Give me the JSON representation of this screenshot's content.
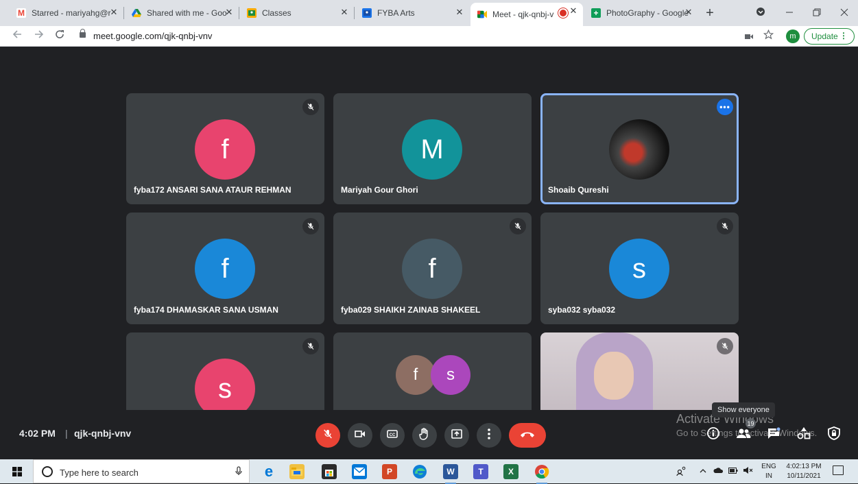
{
  "browser": {
    "tabs": [
      {
        "label": "Starred - mariyahg@r",
        "icon": "gmail-icon",
        "fav_color": "#ea4335",
        "fav_text": "M"
      },
      {
        "label": "Shared with me - Goo",
        "icon": "google-drive-icon",
        "fav_color": "#fbbc04",
        "fav_text": "▲"
      },
      {
        "label": "Classes",
        "icon": "google-classroom-icon",
        "fav_color": "#f9ab00",
        "fav_text": "■"
      },
      {
        "label": "FYBA Arts",
        "icon": "google-classroom-icon",
        "fav_color": "#1a73e8",
        "fav_text": "■"
      },
      {
        "label": "Meet - qjk-qnbj-v",
        "icon": "google-meet-icon",
        "fav_color": "#00832d",
        "fav_text": "■"
      },
      {
        "label": "PhotoGraphy - Google",
        "icon": "google-sheets-icon",
        "fav_color": "#0f9d58",
        "fav_text": "+"
      }
    ],
    "close_glyph": "✕",
    "new_tab_glyph": "+",
    "url": "meet.google.com/qjk-qnbj-vnv",
    "profile_initial": "m",
    "update_label": "Update",
    "menu_glyph": "⋮"
  },
  "meet": {
    "participants": [
      {
        "name": "fyba172 ANSARI SANA ATAUR REHMAN",
        "initial": "f",
        "color": "#e8446e"
      },
      {
        "name": "Mariyah Gour Ghori",
        "initial": "M",
        "color": "#12939a"
      },
      {
        "name": "Shoaib Qureshi",
        "initial": "",
        "color": "#222222"
      },
      {
        "name": "fyba174 DHAMASKAR SANA USMAN",
        "initial": "f",
        "color": "#1a88d8"
      },
      {
        "name": "fyba029 SHAIKH ZAINAB SHAKEEL",
        "initial": "f",
        "color": "#465a65"
      },
      {
        "name": "syba032 syba032",
        "initial": "s",
        "color": "#1a88d8"
      },
      {
        "name": "",
        "initial": "s",
        "color": "#e8446e"
      },
      {
        "name": "",
        "initial": "f",
        "color": "#8d6e63",
        "second_initial": "s",
        "second_color": "#ab47bc"
      },
      {
        "name": "",
        "initial": "",
        "color": "#c9c2c6"
      }
    ],
    "more_glyph": "•••",
    "time": "4:02 PM",
    "divider": "|",
    "meeting_code": "qjk-qnbj-vnv",
    "tooltip": "Show everyone",
    "participant_count": "19",
    "watermark_title": "Activate Windows",
    "watermark_sub": "Go to Settings to activate Windows."
  },
  "taskbar": {
    "search_placeholder": "Type here to search",
    "lang_top": "ENG",
    "lang_bottom": "IN",
    "clock_time": "4:02:13 PM",
    "clock_date": "10/11/2021"
  }
}
